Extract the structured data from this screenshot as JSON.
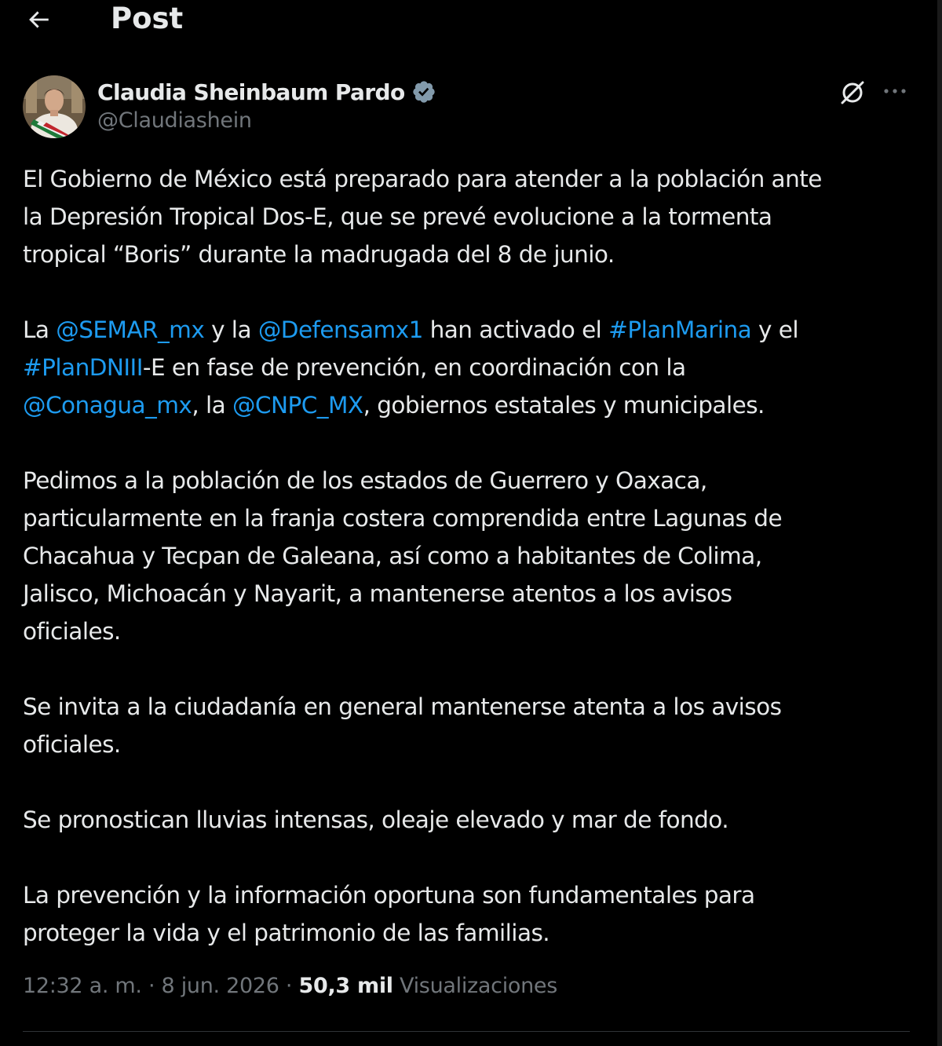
{
  "header": {
    "title": "Post",
    "back_icon": "arrow-left-icon"
  },
  "author": {
    "name": "Claudia Sheinbaum Pardo",
    "handle": "@Claudiashein",
    "verified_color": "#829aab"
  },
  "actions": {
    "grok_icon": "grok-icon",
    "more_icon": "more-horizontal-icon",
    "more_label": "···"
  },
  "tweet": {
    "p1": {
      "l1": "El Gobierno de México está preparado para atender a la población ante",
      "l2": "la Depresión Tropical Dos-E, que se prevé evolucione a la tormenta",
      "l3": "tropical “Boris” durante la madrugada del 8 de junio."
    },
    "p2": {
      "t1": "La ",
      "m1": "@SEMAR_mx",
      "t2": " y la ",
      "m2": "@Defensamx1",
      "t3": " han activado el ",
      "h1": "#PlanMarina",
      "t4": " y el",
      "h2": "#PlanDNIII",
      "t5": "-E en fase de prevención, en coordinación con la",
      "m3": "@Conagua_mx",
      "t6": ", la ",
      "m4": "@CNPC_MX",
      "t7": ", gobiernos estatales y municipales."
    },
    "p3": {
      "l1": "Pedimos a la población de los estados de Guerrero y Oaxaca,",
      "l2": "particularmente en la franja costera comprendida entre Lagunas de",
      "l3": "Chacahua y Tecpan de Galeana, así como a habitantes de Colima,",
      "l4": "Jalisco, Michoacán y Nayarit, a mantenerse atentos a los avisos",
      "l5": "oficiales."
    },
    "p4": {
      "l1": "Se invita a la ciudadanía en general mantenerse atenta a los avisos",
      "l2": "oficiales."
    },
    "p5": {
      "l1": "Se pronostican lluvias intensas, oleaje elevado y mar de fondo."
    },
    "p6": {
      "l1": "La prevención y la información oportuna son fundamentales para",
      "l2": "proteger la vida y el patrimonio de las familias."
    }
  },
  "meta": {
    "time": "12:32 a. m.",
    "sep1": " · ",
    "date": "8 jun. 2026",
    "sep2": " · ",
    "views_count": "50,3 mil",
    "views_label": " Visualizaciones"
  },
  "colors": {
    "background": "#000000",
    "text": "#e7e9ea",
    "secondary": "#71767b",
    "link": "#1d9bf0",
    "divider": "#2f3336"
  }
}
